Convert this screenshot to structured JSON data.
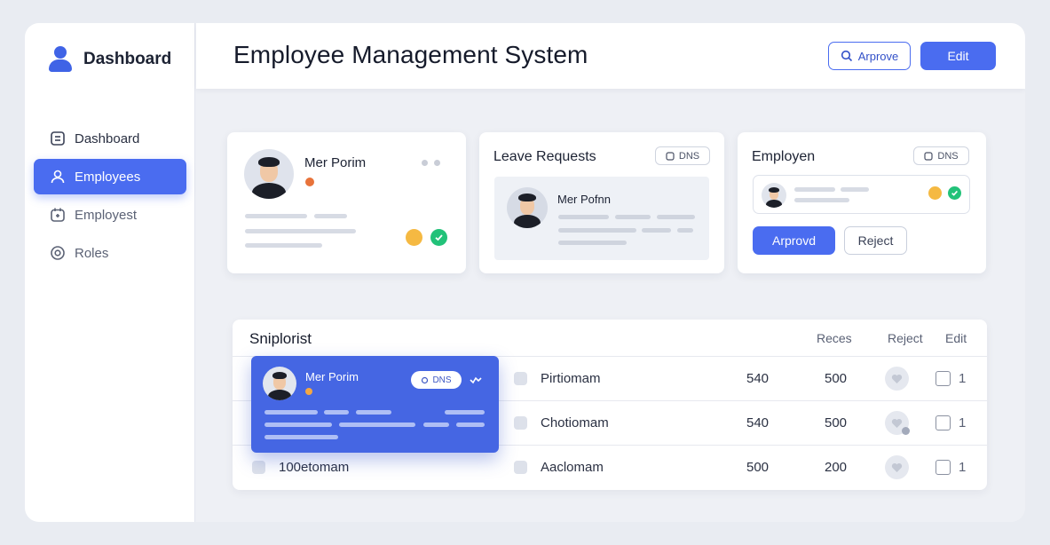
{
  "sidebar": {
    "brand": "Dashboard",
    "items": [
      {
        "label": "Dashboard",
        "icon": "list-icon",
        "active": false
      },
      {
        "label": "Employees",
        "icon": "user-icon",
        "active": true
      },
      {
        "label": "Employest",
        "icon": "calendar-icon",
        "active": false
      },
      {
        "label": "Roles",
        "icon": "shield-icon",
        "active": false
      }
    ]
  },
  "header": {
    "title": "Employee Management System",
    "approve_label": "Arprove",
    "edit_label": "Edit"
  },
  "cards": {
    "profile": {
      "name": "Mer Porim"
    },
    "leave": {
      "title": "Leave Requests",
      "tag": "DNS",
      "name": "Mer Pofnn"
    },
    "employee": {
      "title": "Employen",
      "tag": "DNS",
      "approve_label": "Arprovd",
      "reject_label": "Reject"
    }
  },
  "table": {
    "title": "Sniplorist",
    "headers": {
      "col1": "Reces",
      "col2": "Reject",
      "col3": "Edit"
    },
    "rows": [
      {
        "left": "",
        "name": "Pirtiomam",
        "v1": "540",
        "v2": "500",
        "count": "1"
      },
      {
        "left": "",
        "name": "Chotiomam",
        "v1": "540",
        "v2": "500",
        "count": "1"
      },
      {
        "left": "100etomam",
        "name": "Aaclomam",
        "v1": "500",
        "v2": "200",
        "count": "1"
      }
    ]
  },
  "popup": {
    "name": "Mer Porim",
    "tag": "DNS"
  },
  "colors": {
    "accent": "#4a6cf0",
    "success": "#22c279",
    "warning": "#f5b942",
    "danger": "#e8733a"
  }
}
